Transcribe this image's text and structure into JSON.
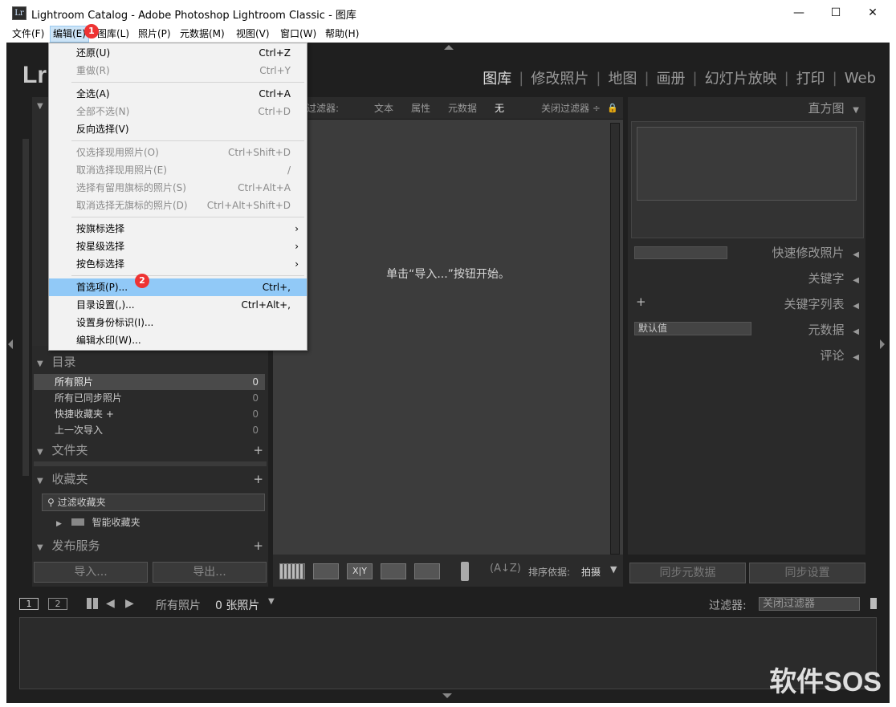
{
  "window": {
    "title": "Lightroom Catalog - Adobe Photoshop Lightroom Classic - 图库",
    "icon_text": "Lr",
    "min": "—",
    "max": "☐",
    "close": "✕"
  },
  "menubar": [
    "文件(F)",
    "编辑(E)",
    "图库(L)",
    "照片(P)",
    "元数据(M)",
    "视图(V)",
    "窗口(W)",
    "帮助(H)"
  ],
  "logo": "Lr",
  "modules": [
    "图库",
    "修改照片",
    "地图",
    "画册",
    "幻灯片放映",
    "打印",
    "Web"
  ],
  "edit_menu": {
    "g1": [
      {
        "label": "还原(U)",
        "shortcut": "Ctrl+Z"
      },
      {
        "label": "重做(R)",
        "shortcut": "Ctrl+Y"
      }
    ],
    "g2": [
      {
        "label": "全选(A)",
        "shortcut": "Ctrl+A"
      },
      {
        "label": "全部不选(N)",
        "shortcut": "Ctrl+D"
      },
      {
        "label": "反向选择(V)",
        "shortcut": ""
      }
    ],
    "g3": [
      {
        "label": "仅选择现用照片(O)",
        "shortcut": "Ctrl+Shift+D"
      },
      {
        "label": "取消选择现用照片(E)",
        "shortcut": "/"
      },
      {
        "label": "选择有留用旗标的照片(S)",
        "shortcut": "Ctrl+Alt+A"
      },
      {
        "label": "取消选择无旗标的照片(D)",
        "shortcut": "Ctrl+Alt+Shift+D"
      }
    ],
    "g4": [
      {
        "label": "按旗标选择",
        "arrow": "›"
      },
      {
        "label": "按星级选择",
        "arrow": "›"
      },
      {
        "label": "按色标选择",
        "arrow": "›"
      }
    ],
    "g5": [
      {
        "label": "首选项(P)...",
        "shortcut": "Ctrl+,"
      },
      {
        "label": "目录设置(,)...",
        "shortcut": "Ctrl+Alt+,"
      },
      {
        "label": "设置身份标识(I)...",
        "shortcut": ""
      },
      {
        "label": "编辑水印(W)...",
        "shortcut": ""
      }
    ]
  },
  "badges": [
    "1",
    "2"
  ],
  "filter_bar": {
    "label": "过滤器:",
    "text": "文本",
    "attr": "属性",
    "meta": "元数据",
    "none": "无",
    "close": "关闭过滤器 ÷",
    "lock": "🔒"
  },
  "center_msg": "单击“导入...”按钮开始。",
  "catalog": {
    "title": "目录",
    "items": [
      {
        "label": "所有照片",
        "count": "0"
      },
      {
        "label": "所有已同步照片",
        "count": "0"
      },
      {
        "label": "快捷收藏夹 +",
        "count": "0"
      },
      {
        "label": "上一次导入",
        "count": "0"
      }
    ]
  },
  "folders_title": "文件夹",
  "collections": {
    "title": "收藏夹",
    "filter": "过滤收藏夹",
    "smart": "智能收藏夹"
  },
  "publish_title": "发布服务",
  "plus": "+",
  "import_btn": "导入...",
  "export_btn": "导出...",
  "right": {
    "histogram": "直方图",
    "quick": "快速修改照片",
    "keywords": "关键字",
    "keyword_list": "关键字列表",
    "metadata_preset": "默认值",
    "metadata": "元数据",
    "comments": "评论",
    "sync_meta": "同步元数据",
    "sync_settings": "同步设置"
  },
  "toolbar": {
    "sort_label": "排序依据:",
    "sort_value": "拍摄"
  },
  "filmstrip": {
    "num1": "1",
    "num2": "2",
    "source": "所有照片",
    "count": "0 张照片",
    "filter_label": "过滤器:",
    "filter_value": "关闭过滤器"
  },
  "watermark": "软件SOS"
}
